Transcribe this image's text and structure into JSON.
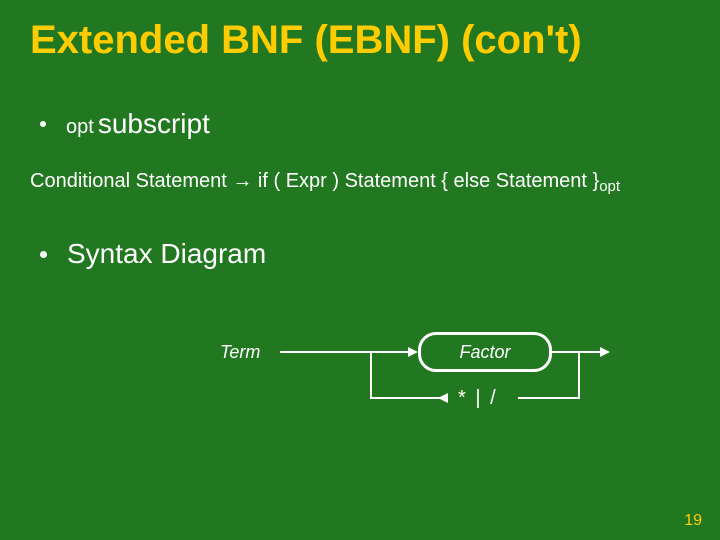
{
  "title": "Extended BNF (EBNF) (con't)",
  "bullet1": {
    "sub": "opt",
    "main": "subscript"
  },
  "rule": {
    "lhs": "Conditional Statement",
    "arrow": "→",
    "rhs": "if ( Expr ) Statement { else Statement }",
    "opt": "opt"
  },
  "bullet2": "Syntax Diagram",
  "diagram": {
    "term": "Term",
    "factor": "Factor",
    "ops": "* | /"
  },
  "page": "19"
}
